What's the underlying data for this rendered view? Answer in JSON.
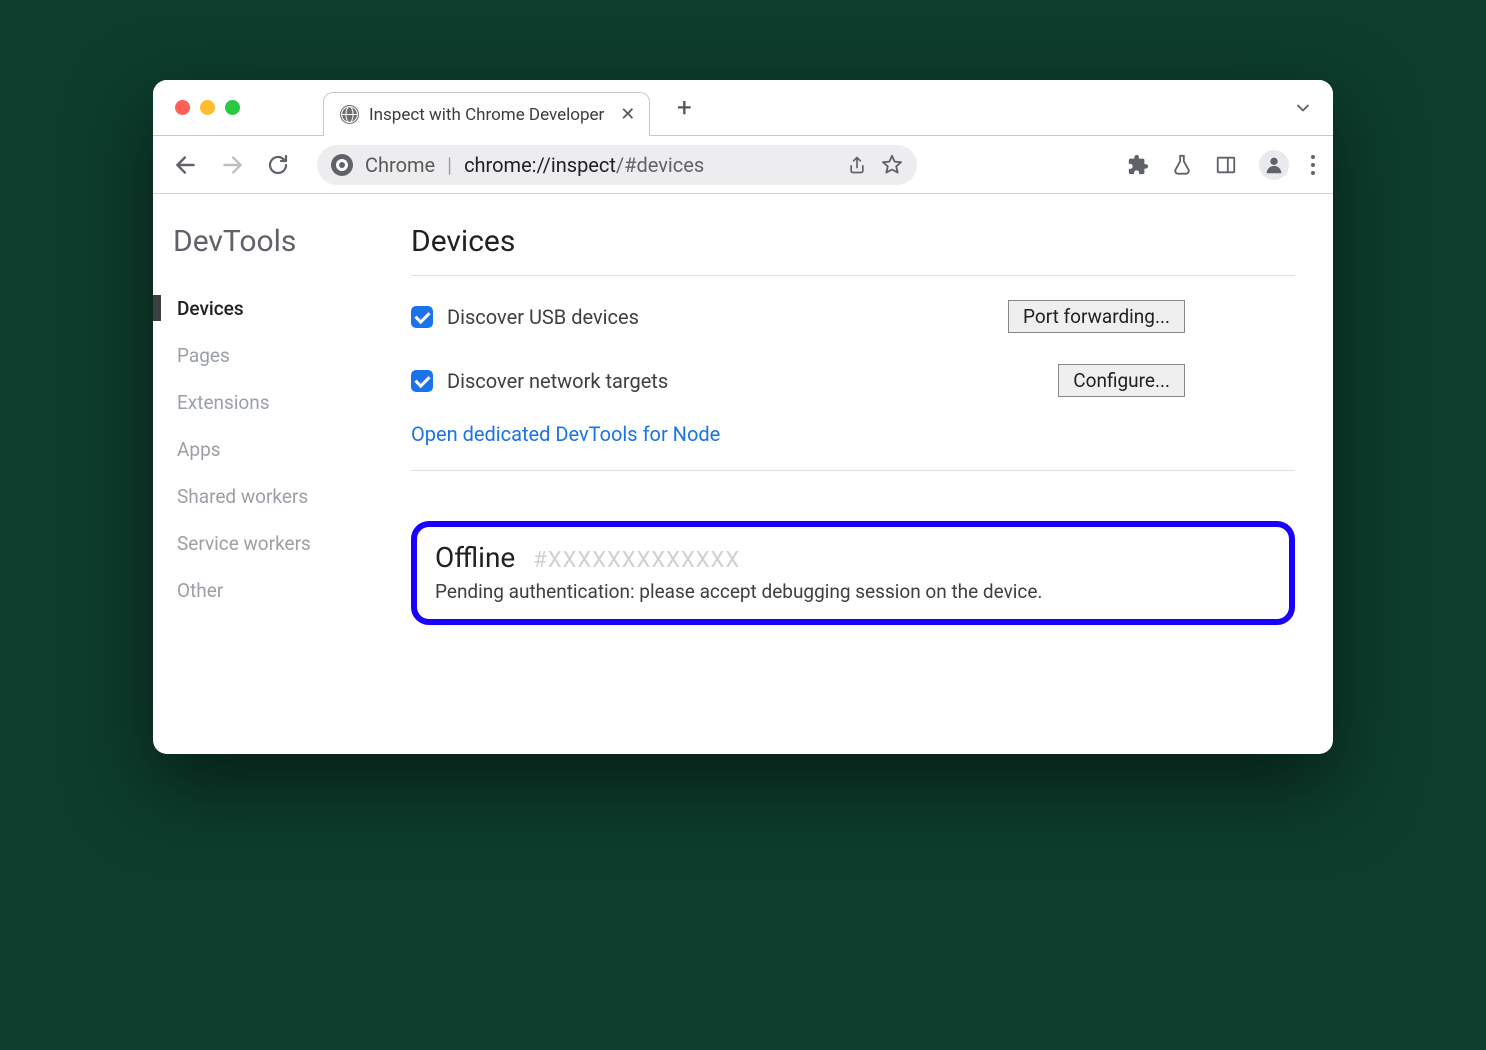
{
  "tab": {
    "title": "Inspect with Chrome Developer"
  },
  "omnibox": {
    "scheme_label": "Chrome",
    "url_strong": "chrome://inspect",
    "url_hash": "/#devices"
  },
  "sidebar": {
    "title": "DevTools",
    "items": [
      {
        "label": "Devices",
        "active": true
      },
      {
        "label": "Pages",
        "active": false
      },
      {
        "label": "Extensions",
        "active": false
      },
      {
        "label": "Apps",
        "active": false
      },
      {
        "label": "Shared workers",
        "active": false
      },
      {
        "label": "Service workers",
        "active": false
      },
      {
        "label": "Other",
        "active": false
      }
    ]
  },
  "main": {
    "title": "Devices",
    "discover_usb": {
      "label": "Discover USB devices",
      "checked": true,
      "button": "Port forwarding..."
    },
    "discover_network": {
      "label": "Discover network targets",
      "checked": true,
      "button": "Configure..."
    },
    "node_link": "Open dedicated DevTools for Node",
    "device": {
      "status": "Offline",
      "id": "#XXXXXXXXXXXXX",
      "message": "Pending authentication: please accept debugging session on the device."
    }
  }
}
